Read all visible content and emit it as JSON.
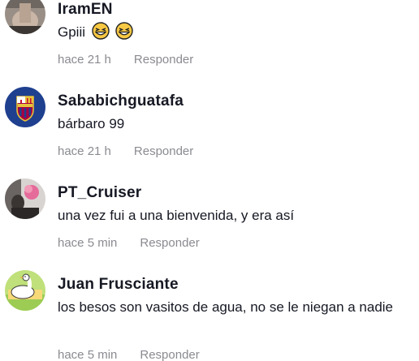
{
  "comments": [
    {
      "username": "IramEN",
      "text": "Gpiii",
      "emojis": [
        "grinning-squinting-face",
        "grinning-squinting-face"
      ],
      "time": "hace 21 h",
      "reply_label": "Responder"
    },
    {
      "username": "Sababichguatafa",
      "text": "bárbaro 99",
      "time": "hace 21 h",
      "reply_label": "Responder"
    },
    {
      "username": "PT_Cruiser",
      "text": "una vez fui a una bienvenida, y era así",
      "time": "hace 5 min",
      "reply_label": "Responder"
    },
    {
      "username": "Juan Frusciante",
      "text": "los besos son vasitos de agua, no se le niegan a nadie",
      "time": "hace 5 min",
      "reply_label": "Responder"
    }
  ],
  "colors": {
    "username": "#161823",
    "meta": "#8a8b91",
    "badge_blue": "#1f3f8f",
    "badge_red": "#a50044"
  }
}
